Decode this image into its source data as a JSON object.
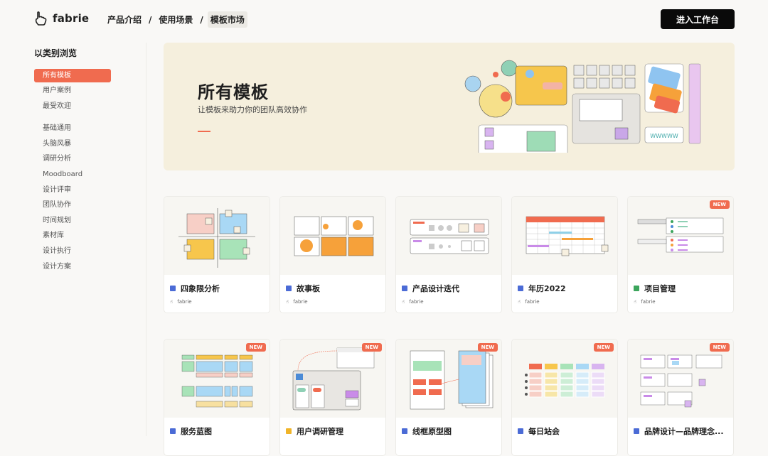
{
  "header": {
    "logo_text": "fabrie",
    "breadcrumbs": [
      "产品介绍",
      "使用场景",
      "模板市场"
    ],
    "cta_label": "进入工作台"
  },
  "sidebar": {
    "title": "以类别浏览",
    "group1": [
      "所有模板",
      "用户案例",
      "最受欢迎"
    ],
    "group2": [
      "基础通用",
      "头脑风暴",
      "调研分析",
      "Moodboard",
      "设计评审",
      "团队协作",
      "时间规划",
      "素材库",
      "设计执行",
      "设计方案"
    ]
  },
  "hero": {
    "title": "所有模板",
    "subtitle": "让模板来助力你的团队高效协作",
    "art_text": "WWWWW"
  },
  "cards": [
    {
      "name": "四象限分析",
      "author": "fabrie",
      "badge": "",
      "icon_color": "#4b6bd6"
    },
    {
      "name": "故事板",
      "author": "fabrie",
      "badge": "",
      "icon_color": "#4b6bd6"
    },
    {
      "name": "产品设计迭代",
      "author": "fabrie",
      "badge": "",
      "icon_color": "#4b6bd6"
    },
    {
      "name": "年历2022",
      "author": "fabrie",
      "badge": "",
      "icon_color": "#4b6bd6"
    },
    {
      "name": "项目管理",
      "author": "fabrie",
      "badge": "NEW",
      "icon_color": "#3ca55c"
    },
    {
      "name": "服务蓝图",
      "author": "",
      "badge": "NEW",
      "icon_color": "#4b6bd6"
    },
    {
      "name": "用户调研管理",
      "author": "",
      "badge": "NEW",
      "icon_color": "#f0b429"
    },
    {
      "name": "线框原型图",
      "author": "",
      "badge": "NEW",
      "icon_color": "#4b6bd6"
    },
    {
      "name": "每日站会",
      "author": "",
      "badge": "NEW",
      "icon_color": "#4b6bd6"
    },
    {
      "name": "品牌设计—品牌理念...",
      "author": "",
      "badge": "NEW",
      "icon_color": "#4b6bd6"
    }
  ],
  "colors": {
    "accent": "#f06b4f",
    "cta_bg": "#0a0a0a"
  }
}
